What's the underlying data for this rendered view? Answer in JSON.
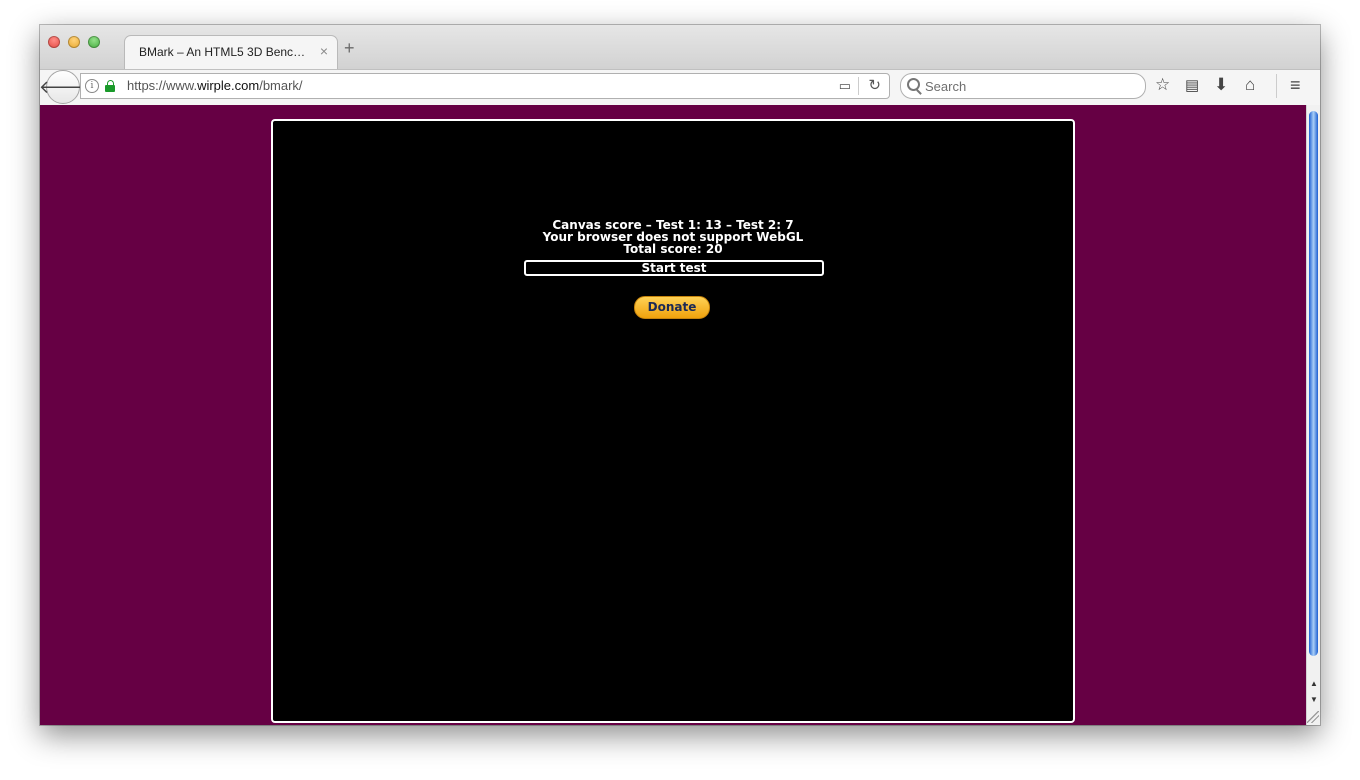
{
  "browser": {
    "tab": {
      "title": "BMark – An HTML5 3D Bench...",
      "close": "×"
    },
    "new_tab": "+",
    "back": "🡐",
    "url": {
      "scheme": "https://www.",
      "host": "wirple.com",
      "path": "/bmark/"
    },
    "reader": "▭",
    "reload": "↻",
    "search_placeholder": "Search",
    "toolbar_icons": {
      "star": "☆",
      "reading_list": "▤",
      "download": "⬇",
      "home": "⌂",
      "menu": "≡"
    }
  },
  "page": {
    "score_lines": [
      "Canvas score – Test 1: 13 – Test 2: 7",
      "Your browser does not support WebGL",
      "Total score: 20"
    ],
    "start_button": "Start test",
    "donate_button": "Donate",
    "colors": {
      "background": "#660044",
      "canvas": "#000000",
      "donate": "#f7b52a"
    }
  },
  "scroll": {
    "up": "▲",
    "down": "▼"
  }
}
